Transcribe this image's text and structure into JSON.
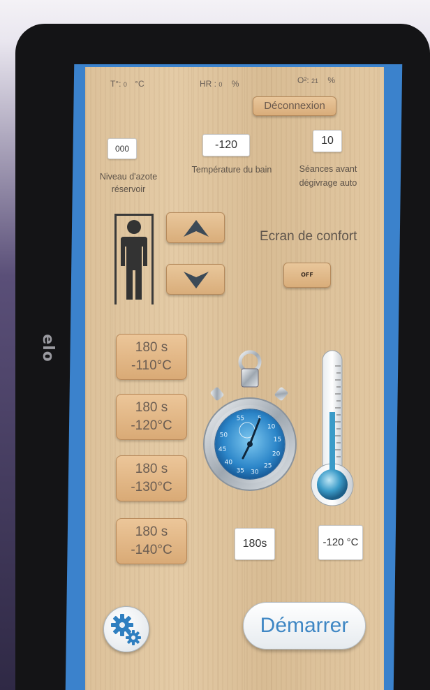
{
  "status": {
    "temp_label": "T°:",
    "temp_value": "0",
    "temp_unit": "°C",
    "hr_label": "HR :",
    "hr_value": "0",
    "hr_unit": "%",
    "o2_label": "O²:",
    "o2_value": "21",
    "o2_unit": "%"
  },
  "logout_label": "Déconnexion",
  "fields": {
    "nitrogen_value": "000",
    "nitrogen_label_1": "Niveau d'azote",
    "nitrogen_label_2": "réservoir",
    "bath_temp_value": "-120",
    "bath_temp_label": "Température du bain",
    "sessions_value": "10",
    "sessions_label_1": "Séances avant",
    "sessions_label_2": "dégivrage auto"
  },
  "comfort": {
    "label": "Ecran de confort",
    "toggle": "OFF"
  },
  "presets": [
    {
      "time": "180 s",
      "temp": "-110°C"
    },
    {
      "time": "180 s",
      "temp": "-120°C"
    },
    {
      "time": "180 s",
      "temp": "-130°C"
    },
    {
      "time": "180 s",
      "temp": "-140°C"
    }
  ],
  "stopwatch_ticks": [
    "55",
    "5",
    "10",
    "15",
    "20",
    "25",
    "30",
    "35",
    "40",
    "45",
    "50"
  ],
  "timer_value": "180s",
  "temperature_value": "-120 °C",
  "start_label": "Démarrer",
  "brand": "elo",
  "colors": {
    "accent": "#3b82cc",
    "start_text": "#3f87c4",
    "wood": "#dcc19a"
  }
}
